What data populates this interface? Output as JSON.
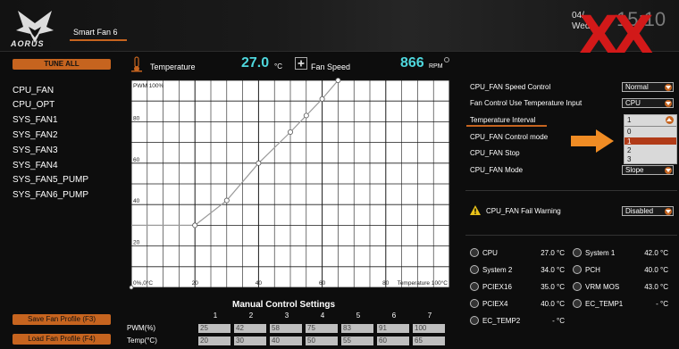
{
  "header": {
    "brand": "AORUS",
    "tab": "Smart Fan 6",
    "date": "04/",
    "day": "Wed",
    "time": "15:10",
    "watermark": "XX"
  },
  "left": {
    "tune_all": "TUNE ALL",
    "fans": [
      "CPU_FAN",
      "CPU_OPT",
      "SYS_FAN1",
      "SYS_FAN2",
      "SYS_FAN3",
      "SYS_FAN4",
      "SYS_FAN5_PUMP",
      "SYS_FAN6_PUMP"
    ],
    "save_profile": "Save Fan Profile (F3)",
    "load_profile": "Load Fan Profile (F4)"
  },
  "readouts": {
    "temp_label": "Temperature",
    "temp_value": "27.0",
    "temp_unit": "°C",
    "fan_label": "Fan Speed",
    "rpm_value": "866",
    "rpm_unit": "RPM"
  },
  "chart_data": {
    "type": "line",
    "ylabel": "PWM 100%",
    "xlabel": "Temperature 100°C",
    "origin_label": "0%,0°C",
    "x_ticks": [
      "20",
      "40",
      "60",
      "80"
    ],
    "y_ticks": [
      "80",
      "60",
      "40",
      "20"
    ],
    "xlim": [
      0,
      100
    ],
    "ylim": [
      0,
      100
    ],
    "grid": true,
    "points": [
      [
        0,
        30
      ],
      [
        20,
        30
      ],
      [
        30,
        42
      ],
      [
        40,
        60
      ],
      [
        50,
        75
      ],
      [
        55,
        83
      ],
      [
        60,
        91
      ],
      [
        65,
        100
      ]
    ]
  },
  "manual": {
    "title": "Manual Control Settings",
    "pwm_label": "PWM(%)",
    "temp_label": "Temp(°C)",
    "columns": [
      "1",
      "2",
      "3",
      "4",
      "5",
      "6",
      "7"
    ],
    "pwm": [
      "25",
      "42",
      "58",
      "75",
      "83",
      "91",
      "100"
    ],
    "temp": [
      "20",
      "30",
      "40",
      "50",
      "55",
      "60",
      "65"
    ]
  },
  "settings": {
    "rows": [
      {
        "label": "CPU_FAN Speed Control",
        "value": "Normal"
      },
      {
        "label": "Fan Control Use Temperature Input",
        "value": "CPU"
      },
      {
        "label": "Temperature Interval",
        "value": ""
      },
      {
        "label": "CPU_FAN Control mode",
        "value": ""
      },
      {
        "label": "CPU_FAN Stop",
        "value": ""
      },
      {
        "label": "CPU_FAN Mode",
        "value": "Slope"
      }
    ],
    "popup_current": "1",
    "popup_options": [
      "0",
      "1",
      "2",
      "3"
    ],
    "fail_label": "CPU_FAN Fail Warning",
    "fail_value": "Disabled"
  },
  "monitor": [
    {
      "label": "CPU",
      "value": "27.0 °C"
    },
    {
      "label": "System 1",
      "value": "42.0 °C"
    },
    {
      "label": "System 2",
      "value": "34.0 °C"
    },
    {
      "label": "PCH",
      "value": "40.0 °C"
    },
    {
      "label": "PCIEX16",
      "value": "35.0 °C"
    },
    {
      "label": "VRM MOS",
      "value": "43.0 °C"
    },
    {
      "label": "PCIEX4",
      "value": "40.0 °C"
    },
    {
      "label": "EC_TEMP1",
      "value": "- °C"
    },
    {
      "label": "EC_TEMP2",
      "value": "- °C"
    }
  ],
  "colors": {
    "accent": "#c6641f",
    "value": "#4ed6dc",
    "warning": "#e8c21a"
  }
}
